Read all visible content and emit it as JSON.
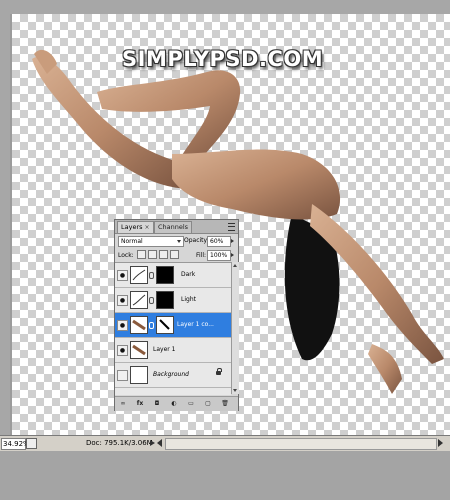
{
  "window": {
    "watermark": "SIMPLYPSD.COM"
  },
  "layers_panel": {
    "tabs": [
      {
        "label": "Layers",
        "close": "×"
      },
      {
        "label": "Channels"
      }
    ],
    "blend_mode": "Normal",
    "opacity_label": "Opacity:",
    "opacity_value": "60%",
    "lock_label": "Lock:",
    "fill_label": "Fill:",
    "fill_value": "100%",
    "layers": [
      {
        "name": "Dark",
        "visible": true
      },
      {
        "name": "Light",
        "visible": true
      },
      {
        "name": "Layer 1 co...",
        "visible": true,
        "selected": true
      },
      {
        "name": "Layer 1",
        "visible": true
      },
      {
        "name": "Background",
        "visible": false,
        "locked": true
      }
    ],
    "footer_icons": [
      "link-icon",
      "fx-icon",
      "mask-icon",
      "adjustment-icon",
      "folder-icon",
      "new-layer-icon",
      "trash-icon"
    ],
    "footer_glyphs": [
      "∞",
      "fx",
      "◘",
      "◐",
      "▭",
      "▢",
      "🗑"
    ]
  },
  "status_bar": {
    "zoom": "34.92%",
    "doc_info": "Doc: 795.1K/3.06M"
  },
  "colors": {
    "selection": "#2f7ee0",
    "canvas_checker": "#cfcfcf"
  }
}
